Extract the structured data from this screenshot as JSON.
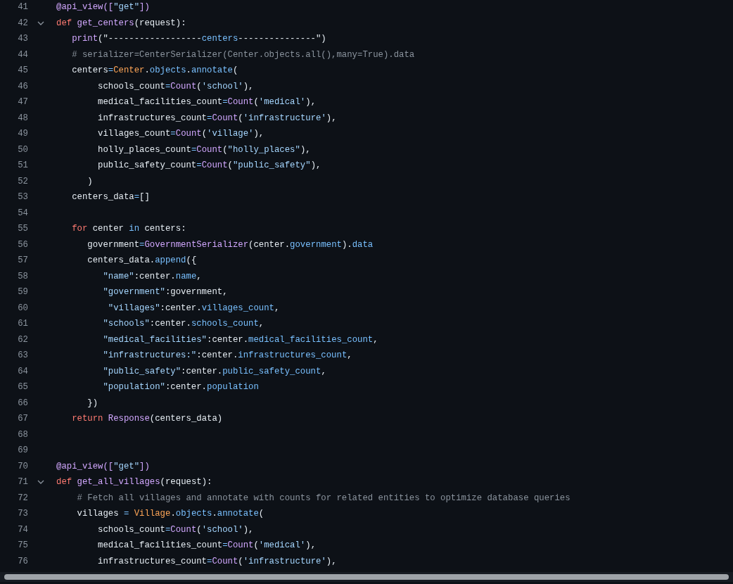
{
  "code_lines": [
    {
      "number": "41",
      "foldable": false,
      "tokens": [
        {
          "kind": "func",
          "text": "@api_view(["
        },
        {
          "kind": "string",
          "text": "\"get\""
        },
        {
          "kind": "func",
          "text": "])"
        }
      ]
    },
    {
      "number": "42",
      "foldable": true,
      "tokens": [
        {
          "kind": "keyword",
          "text": "def "
        },
        {
          "kind": "func",
          "text": "get_centers"
        },
        {
          "kind": "plain",
          "text": "(request):"
        }
      ]
    },
    {
      "number": "43",
      "foldable": false,
      "tokens": [
        {
          "kind": "func",
          "text": "   print"
        },
        {
          "kind": "plain",
          "text": "(\"------------------"
        },
        {
          "kind": "prop",
          "text": "centers"
        },
        {
          "kind": "plain",
          "text": "---------------\")"
        }
      ]
    },
    {
      "number": "44",
      "foldable": false,
      "tokens": [
        {
          "kind": "comment",
          "text": "   # serializer=CenterSerializer(Center.objects.all(),many=True).data"
        }
      ]
    },
    {
      "number": "45",
      "foldable": false,
      "tokens": [
        {
          "kind": "plain",
          "text": "   centers"
        },
        {
          "kind": "op",
          "text": "="
        },
        {
          "kind": "class",
          "text": "Center"
        },
        {
          "kind": "plain",
          "text": "."
        },
        {
          "kind": "prop",
          "text": "objects"
        },
        {
          "kind": "plain",
          "text": "."
        },
        {
          "kind": "prop",
          "text": "annotate"
        },
        {
          "kind": "plain",
          "text": "("
        }
      ]
    },
    {
      "number": "46",
      "foldable": false,
      "tokens": [
        {
          "kind": "plain",
          "text": "        schools_count"
        },
        {
          "kind": "op",
          "text": "="
        },
        {
          "kind": "func",
          "text": "Count"
        },
        {
          "kind": "plain",
          "text": "("
        },
        {
          "kind": "string",
          "text": "'school'"
        },
        {
          "kind": "plain",
          "text": "),"
        }
      ]
    },
    {
      "number": "47",
      "foldable": false,
      "tokens": [
        {
          "kind": "plain",
          "text": "        medical_facilities_count"
        },
        {
          "kind": "op",
          "text": "="
        },
        {
          "kind": "func",
          "text": "Count"
        },
        {
          "kind": "plain",
          "text": "("
        },
        {
          "kind": "string",
          "text": "'medical'"
        },
        {
          "kind": "plain",
          "text": "),"
        }
      ]
    },
    {
      "number": "48",
      "foldable": false,
      "tokens": [
        {
          "kind": "plain",
          "text": "        infrastructures_count"
        },
        {
          "kind": "op",
          "text": "="
        },
        {
          "kind": "func",
          "text": "Count"
        },
        {
          "kind": "plain",
          "text": "("
        },
        {
          "kind": "string",
          "text": "'infrastructure'"
        },
        {
          "kind": "plain",
          "text": "),"
        }
      ]
    },
    {
      "number": "49",
      "foldable": false,
      "tokens": [
        {
          "kind": "plain",
          "text": "        villages_count"
        },
        {
          "kind": "op",
          "text": "="
        },
        {
          "kind": "func",
          "text": "Count"
        },
        {
          "kind": "plain",
          "text": "("
        },
        {
          "kind": "string",
          "text": "'village'"
        },
        {
          "kind": "plain",
          "text": "),"
        }
      ]
    },
    {
      "number": "50",
      "foldable": false,
      "tokens": [
        {
          "kind": "plain",
          "text": "        holly_places_count"
        },
        {
          "kind": "op",
          "text": "="
        },
        {
          "kind": "func",
          "text": "Count"
        },
        {
          "kind": "plain",
          "text": "("
        },
        {
          "kind": "string",
          "text": "\"holly_places\""
        },
        {
          "kind": "plain",
          "text": "),"
        }
      ]
    },
    {
      "number": "51",
      "foldable": false,
      "tokens": [
        {
          "kind": "plain",
          "text": "        public_safety_count"
        },
        {
          "kind": "op",
          "text": "="
        },
        {
          "kind": "func",
          "text": "Count"
        },
        {
          "kind": "plain",
          "text": "("
        },
        {
          "kind": "string",
          "text": "\"public_safety\""
        },
        {
          "kind": "plain",
          "text": "),"
        }
      ]
    },
    {
      "number": "52",
      "foldable": false,
      "tokens": [
        {
          "kind": "plain",
          "text": "      )"
        }
      ]
    },
    {
      "number": "53",
      "foldable": false,
      "tokens": [
        {
          "kind": "plain",
          "text": "   centers_data"
        },
        {
          "kind": "op",
          "text": "="
        },
        {
          "kind": "plain",
          "text": "[]"
        }
      ]
    },
    {
      "number": "54",
      "foldable": false
    },
    {
      "number": "55",
      "foldable": false,
      "tokens": [
        {
          "kind": "keyword",
          "text": "   for"
        },
        {
          "kind": "plain",
          "text": " center "
        },
        {
          "kind": "prop",
          "text": "in"
        },
        {
          "kind": "plain",
          "text": " centers:"
        }
      ]
    },
    {
      "number": "56",
      "foldable": false,
      "tokens": [
        {
          "kind": "plain",
          "text": "      government"
        },
        {
          "kind": "op",
          "text": "="
        },
        {
          "kind": "func",
          "text": "GovernmentSerializer"
        },
        {
          "kind": "plain",
          "text": "(center."
        },
        {
          "kind": "prop",
          "text": "government"
        },
        {
          "kind": "plain",
          "text": ")."
        },
        {
          "kind": "prop",
          "text": "data"
        }
      ]
    },
    {
      "number": "57",
      "foldable": false,
      "tokens": [
        {
          "kind": "plain",
          "text": "      centers_data."
        },
        {
          "kind": "prop",
          "text": "append"
        },
        {
          "kind": "plain",
          "text": "({"
        }
      ]
    },
    {
      "number": "58",
      "foldable": false,
      "tokens": [
        {
          "kind": "string",
          "text": "         \"name\""
        },
        {
          "kind": "plain",
          "text": ":center."
        },
        {
          "kind": "prop",
          "text": "name"
        },
        {
          "kind": "plain",
          "text": ","
        }
      ]
    },
    {
      "number": "59",
      "foldable": false,
      "tokens": [
        {
          "kind": "string",
          "text": "         \"government\""
        },
        {
          "kind": "plain",
          "text": ":government,"
        }
      ]
    },
    {
      "number": "60",
      "foldable": false,
      "tokens": [
        {
          "kind": "string",
          "text": "          \"villages\""
        },
        {
          "kind": "plain",
          "text": ":center."
        },
        {
          "kind": "prop",
          "text": "villages_count"
        },
        {
          "kind": "plain",
          "text": ","
        }
      ]
    },
    {
      "number": "61",
      "foldable": false,
      "tokens": [
        {
          "kind": "string",
          "text": "         \"schools\""
        },
        {
          "kind": "plain",
          "text": ":center."
        },
        {
          "kind": "prop",
          "text": "schools_count"
        },
        {
          "kind": "plain",
          "text": ","
        }
      ]
    },
    {
      "number": "62",
      "foldable": false,
      "tokens": [
        {
          "kind": "string",
          "text": "         \"medical_facilities\""
        },
        {
          "kind": "plain",
          "text": ":center."
        },
        {
          "kind": "prop",
          "text": "medical_facilities_count"
        },
        {
          "kind": "plain",
          "text": ","
        }
      ]
    },
    {
      "number": "63",
      "foldable": false,
      "tokens": [
        {
          "kind": "string",
          "text": "         \"infrastructures:\""
        },
        {
          "kind": "plain",
          "text": ":center."
        },
        {
          "kind": "prop",
          "text": "infrastructures_count"
        },
        {
          "kind": "plain",
          "text": ","
        }
      ]
    },
    {
      "number": "64",
      "foldable": false,
      "tokens": [
        {
          "kind": "string",
          "text": "         \"public_safety\""
        },
        {
          "kind": "plain",
          "text": ":center."
        },
        {
          "kind": "prop",
          "text": "public_safety_count"
        },
        {
          "kind": "plain",
          "text": ","
        }
      ]
    },
    {
      "number": "65",
      "foldable": false,
      "tokens": [
        {
          "kind": "string",
          "text": "         \"population\""
        },
        {
          "kind": "plain",
          "text": ":center."
        },
        {
          "kind": "prop",
          "text": "population"
        }
      ]
    },
    {
      "number": "66",
      "foldable": false,
      "tokens": [
        {
          "kind": "plain",
          "text": "      })"
        }
      ]
    },
    {
      "number": "67",
      "foldable": false,
      "tokens": [
        {
          "kind": "keyword",
          "text": "   return "
        },
        {
          "kind": "func",
          "text": "Response"
        },
        {
          "kind": "plain",
          "text": "(centers_data)"
        }
      ]
    },
    {
      "number": "68",
      "foldable": false
    },
    {
      "number": "69",
      "foldable": false
    },
    {
      "number": "70",
      "foldable": false,
      "tokens": [
        {
          "kind": "func",
          "text": "@api_view(["
        },
        {
          "kind": "string",
          "text": "\"get\""
        },
        {
          "kind": "func",
          "text": "])"
        }
      ]
    },
    {
      "number": "71",
      "foldable": true,
      "tokens": [
        {
          "kind": "keyword",
          "text": "def "
        },
        {
          "kind": "func",
          "text": "get_all_villages"
        },
        {
          "kind": "plain",
          "text": "(request):"
        }
      ]
    },
    {
      "number": "72",
      "foldable": false,
      "tokens": [
        {
          "kind": "comment",
          "text": "    # Fetch all villages and annotate with counts for related entities to optimize database queries"
        }
      ]
    },
    {
      "number": "73",
      "foldable": false,
      "tokens": [
        {
          "kind": "plain",
          "text": "    villages "
        },
        {
          "kind": "op",
          "text": "="
        },
        {
          "kind": "class",
          "text": " Village"
        },
        {
          "kind": "plain",
          "text": "."
        },
        {
          "kind": "prop",
          "text": "objects"
        },
        {
          "kind": "plain",
          "text": "."
        },
        {
          "kind": "prop",
          "text": "annotate"
        },
        {
          "kind": "plain",
          "text": "("
        }
      ]
    },
    {
      "number": "74",
      "foldable": false,
      "tokens": [
        {
          "kind": "plain",
          "text": "        schools_count"
        },
        {
          "kind": "op",
          "text": "="
        },
        {
          "kind": "func",
          "text": "Count"
        },
        {
          "kind": "plain",
          "text": "("
        },
        {
          "kind": "string",
          "text": "'school'"
        },
        {
          "kind": "plain",
          "text": "),"
        }
      ]
    },
    {
      "number": "75",
      "foldable": false,
      "tokens": [
        {
          "kind": "plain",
          "text": "        medical_facilities_count"
        },
        {
          "kind": "op",
          "text": "="
        },
        {
          "kind": "func",
          "text": "Count"
        },
        {
          "kind": "plain",
          "text": "("
        },
        {
          "kind": "string",
          "text": "'medical'"
        },
        {
          "kind": "plain",
          "text": "),"
        }
      ]
    },
    {
      "number": "76",
      "foldable": false,
      "tokens": [
        {
          "kind": "plain",
          "text": "        infrastructures_count"
        },
        {
          "kind": "op",
          "text": "="
        },
        {
          "kind": "func",
          "text": "Count"
        },
        {
          "kind": "plain",
          "text": "("
        },
        {
          "kind": "string",
          "text": "'infrastructure'"
        },
        {
          "kind": "plain",
          "text": "),"
        }
      ]
    }
  ]
}
